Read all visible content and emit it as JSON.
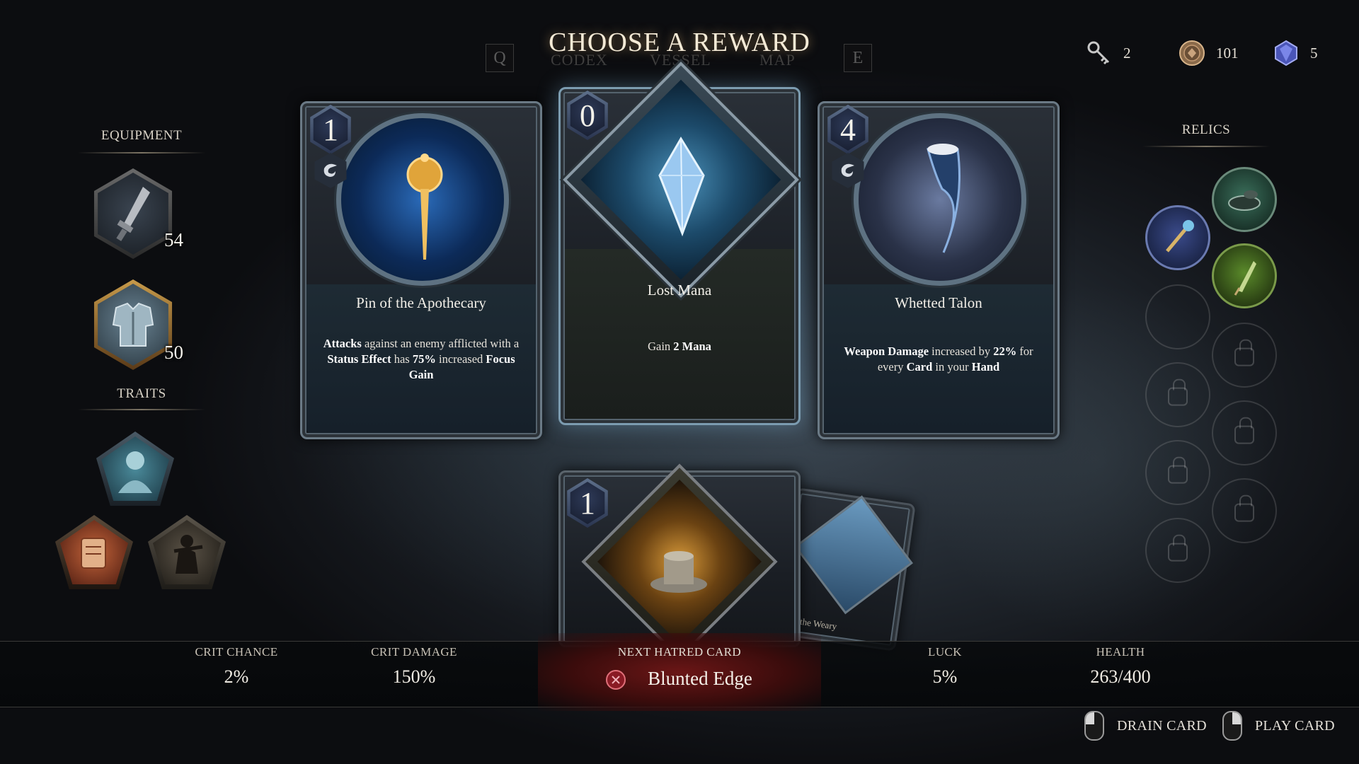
{
  "header": {
    "title": "CHOOSE A REWARD",
    "tabs": [
      {
        "key": "Q",
        "label": ""
      },
      {
        "key": "",
        "label": "CODEX"
      },
      {
        "key": "",
        "label": "VESSEL"
      },
      {
        "key": "",
        "label": "MAP"
      },
      {
        "key": "E",
        "label": ""
      }
    ]
  },
  "currencies": [
    {
      "icon": "key-icon",
      "value": "2"
    },
    {
      "icon": "coin-icon",
      "value": "101"
    },
    {
      "icon": "crystal-icon",
      "value": "5"
    }
  ],
  "equipment": {
    "title": "EQUIPMENT",
    "items": [
      {
        "icon": "sword-icon",
        "value": "54"
      },
      {
        "icon": "armor-icon",
        "value": "50"
      }
    ]
  },
  "traits": {
    "title": "TRAITS",
    "items": [
      {
        "icon": "warrior-portrait-icon"
      },
      {
        "icon": "scroll-icon"
      },
      {
        "icon": "figure-icon"
      }
    ]
  },
  "relics": {
    "title": "RELICS",
    "slots": [
      {
        "state": "filled",
        "icon": "bowl-relic-icon"
      },
      {
        "state": "filled",
        "icon": "staff-relic-icon"
      },
      {
        "state": "filled",
        "icon": "quill-relic-icon"
      },
      {
        "state": "empty"
      },
      {
        "state": "locked"
      },
      {
        "state": "locked"
      },
      {
        "state": "locked"
      },
      {
        "state": "locked"
      },
      {
        "state": "locked"
      },
      {
        "state": "locked"
      }
    ]
  },
  "reward_cards": [
    {
      "cost": "1",
      "name": "Pin of the Apothecary",
      "desc_parts": [
        {
          "b": true,
          "t": "Attacks"
        },
        {
          "b": false,
          "t": " against an enemy afflicted with a "
        },
        {
          "b": true,
          "t": "Status Effect"
        },
        {
          "b": false,
          "t": " has "
        },
        {
          "b": true,
          "t": "75%"
        },
        {
          "b": false,
          "t": " increased "
        },
        {
          "b": true,
          "t": "Focus Gain"
        }
      ]
    },
    {
      "cost": "0",
      "name": "Lost Mana",
      "desc_parts": [
        {
          "b": false,
          "t": "Gain "
        },
        {
          "b": true,
          "t": "2 Mana"
        }
      ]
    },
    {
      "cost": "4",
      "name": "Whetted Talon",
      "desc_parts": [
        {
          "b": true,
          "t": "Weapon Damage"
        },
        {
          "b": false,
          "t": " increased by "
        },
        {
          "b": true,
          "t": "22%"
        },
        {
          "b": false,
          "t": " for every "
        },
        {
          "b": true,
          "t": "Card"
        },
        {
          "b": false,
          "t": " in your "
        },
        {
          "b": true,
          "t": "Hand"
        }
      ]
    }
  ],
  "hand": {
    "front_card_cost": "1",
    "back_card_partial_name": "or the Weary"
  },
  "stats": [
    {
      "label": "CRIT CHANCE",
      "value": "2%"
    },
    {
      "label": "CRIT DAMAGE",
      "value": "150%"
    },
    {
      "label": "LUCK",
      "value": "5%"
    },
    {
      "label": "HEALTH",
      "value": "263/400"
    }
  ],
  "hatred": {
    "label": "NEXT HATRED CARD",
    "value": "Blunted Edge"
  },
  "controls": [
    {
      "label": "DRAIN CARD"
    },
    {
      "label": "PLAY CARD"
    }
  ]
}
